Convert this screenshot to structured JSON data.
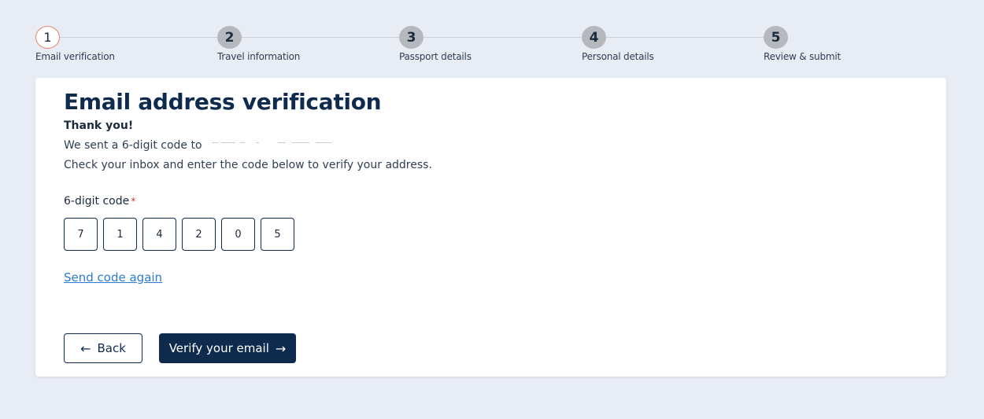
{
  "stepper": {
    "steps": [
      {
        "number": "1",
        "label": "Email verification",
        "state": "active"
      },
      {
        "number": "2",
        "label": "Travel information",
        "state": "upcoming"
      },
      {
        "number": "3",
        "label": "Passport details",
        "state": "upcoming"
      },
      {
        "number": "4",
        "label": "Personal details",
        "state": "upcoming"
      },
      {
        "number": "5",
        "label": "Review & submit",
        "state": "upcoming"
      }
    ]
  },
  "card": {
    "title": "Email address verification",
    "thanks": "Thank you!",
    "sent_prefix": "We sent a 6-digit code to",
    "instructions": "Check your inbox and enter the code below to verify your address.",
    "code_label": "6-digit code",
    "required_marker": "*",
    "code_digits": [
      "7",
      "1",
      "4",
      "2",
      "0",
      "5"
    ],
    "resend_link": "Send code again",
    "back_button": {
      "icon": "arrow-left-icon",
      "glyph": "←",
      "label": "Back"
    },
    "verify_button": {
      "label": "Verify your email",
      "icon": "arrow-right-icon",
      "glyph": "→"
    }
  },
  "colors": {
    "page_background": "#e8ecf5",
    "primary": "#0e2a4d",
    "link": "#2a7bd1",
    "active_step_border": "#e8866c",
    "inactive_step": "#b5b8bd",
    "required": "#d0312d"
  }
}
